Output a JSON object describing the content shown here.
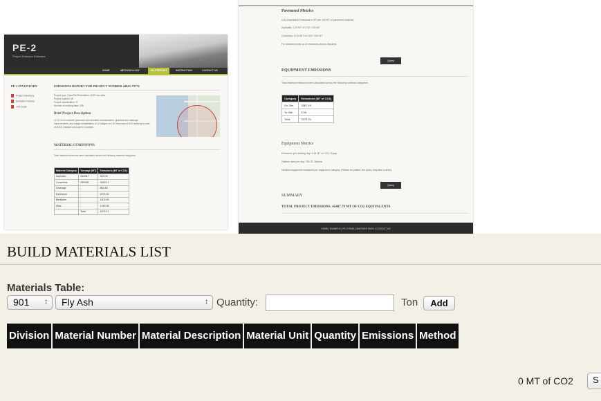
{
  "left_shot": {
    "logo": "PE-2",
    "logo_sub": "Project Emission Estimator",
    "nav": [
      "HOME",
      "METHODOLOGY",
      "PE-2 REPORT",
      "INSTRUCTION",
      "CONTACT US"
    ],
    "sidebar_title": "PE-2 INVENTORY",
    "sidebar_items": [
      "Project Inventory",
      "Emission Factors",
      "Job Costs"
    ],
    "report_title": "EMISSIONS REPORT FOR PROJECT NUMBER 44043-79776",
    "project_info": [
      "Project type: Cass/Old Revisitation, M-59 low rates",
      "Project location: MI",
      "Project classification: R",
      "Number of working days: 356"
    ],
    "brief_title": "Brief Project Description",
    "brief_text": "12.31 mi of concrete pavement and shoulder reconstruction, guardrail and drainage improvements, and bridge rehabilitation of 12 bridges on I-94 from east of M-5 northerly to east of M-53, Oakland and Lapeer Counties.",
    "materials_title": "MATERIALS EMISSIONS",
    "materials_note": "Total material emissions were calculated across the following material categories.",
    "materials_table": {
      "headers": [
        "Material Category",
        "Tonnage (MT)",
        "Emissions (MT of CO2)"
      ],
      "rows": [
        [
          "Asphaltic",
          "24428.7",
          "300.03"
        ],
        [
          "Concretus",
          "295108",
          "34521.2"
        ],
        [
          "Drainage",
          "-",
          "864.85"
        ],
        [
          "Earthwork",
          "-",
          "2075.32"
        ],
        [
          "Bentlybrn",
          "-",
          "1402.65"
        ],
        [
          "Misc.",
          "-",
          "1349.08"
        ],
        [
          "",
          "Total",
          "40712.1"
        ]
      ]
    }
  },
  "right_shot": {
    "pavement_title": "Pavement Metrics",
    "pavement_lines": [
      "CO2 Equivalent Emissions in MT per 100 MT of pavement material:",
      "Asphaltic: 1.23 MT of CO2 / 100 MT",
      "Concretus: 11.54 MT of CO2 / 100 MT",
      "For detailed break up of emissions across divisions:"
    ],
    "query_label": "Query",
    "equipment_title": "EQUIPMENT EMISSIONS",
    "equipment_note": "Total material emissions were calculated across the following material categories.",
    "equipment_table": {
      "headers": [
        "Category",
        "Emissions (MT of CO2)"
      ],
      "rows": [
        [
          "On Site",
          "3367.49"
        ],
        [
          "To Site",
          "5.55"
        ],
        [
          "Total",
          "3373.04"
        ]
      ]
    },
    "equipment_metrics_title": "Equipment Metrics",
    "equipment_lines": [
      "Emissions per working day: 9.44 MT of CO2 / Equip",
      "Gallons used per day: 781.31 Gallons",
      "Detailed equipment emissions per equipment category. (Please be patient, the query may take a while)"
    ],
    "query2_label": "Query",
    "summary_title": "SUMMARY",
    "total_line": "TOTAL PROJECT EMISSIONS: 45487.79 MT OF CO2 EQUIVALENTS",
    "footer": "HOME | EXAMPLE | PE-2 PAGE | ANOTHER PAGE | CONTACT US"
  },
  "form": {
    "title": "BUILD MATERIALS LIST",
    "table_label": "Materials Table:",
    "division_value": "901",
    "material_value": "Fly Ash",
    "quantity_label": "Quantity:",
    "quantity_value": "",
    "unit_label": "Ton",
    "add_label": "Add",
    "columns": [
      "Division",
      "Material Number",
      "Material Description",
      "Material Unit",
      "Quantity",
      "Emissions",
      "Method"
    ],
    "total_label": "0 MT of CO2",
    "cut_button_label": "S"
  }
}
